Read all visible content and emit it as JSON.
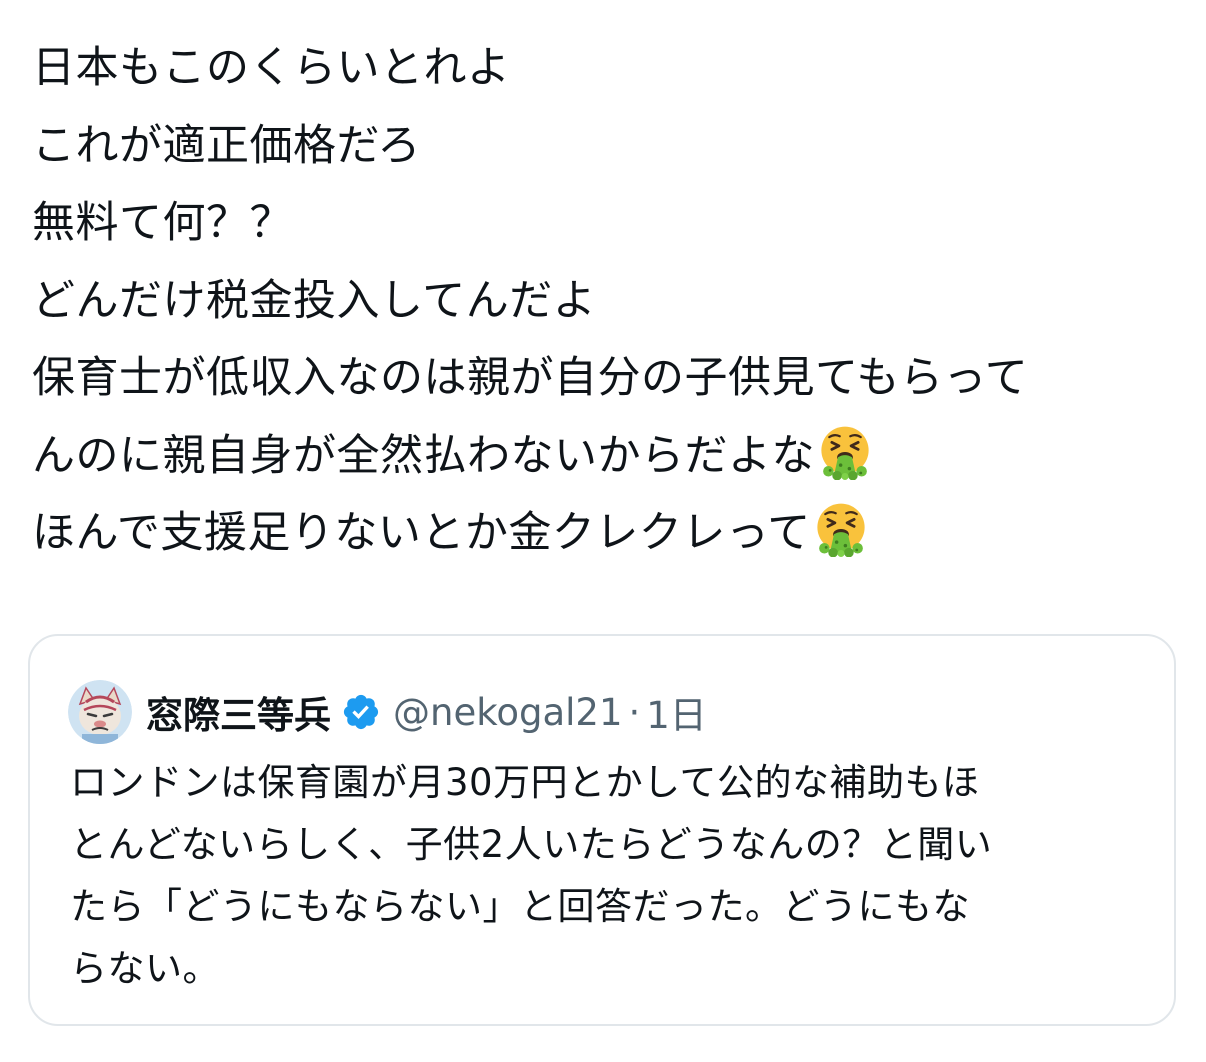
{
  "tweet": {
    "lines": [
      {
        "text": "日本もこのくらいとれよ",
        "emoji": ""
      },
      {
        "text": "これが適正価格だろ",
        "emoji": ""
      },
      {
        "text": "無料て何？？",
        "emoji": ""
      },
      {
        "text": "どんだけ税金投入してんだよ",
        "emoji": ""
      },
      {
        "text": "保育士が低収入なのは親が自分の子供見てもらって",
        "emoji": ""
      },
      {
        "text": "んのに親自身が全然払わないからだよな",
        "emoji": "vomiting-face-icon"
      },
      {
        "text": "ほんで支援足りないとか金クレクレって",
        "emoji": "vomiting-face-icon"
      }
    ]
  },
  "quoted_post": {
    "author_name": "窓際三等兵",
    "author_handle": "@nekogal21",
    "separator": "·",
    "age": "1日",
    "verified": true,
    "verified_color": "#1d9bf0",
    "lines": [
      "ロンドンは保育園が月30万円とかして公的な補助もほ",
      "とんどないらしく、子供2人いたらどうなんの？と聞い",
      "たら「どうにもならない」と回答だった。どうにもな",
      "らない。"
    ]
  }
}
